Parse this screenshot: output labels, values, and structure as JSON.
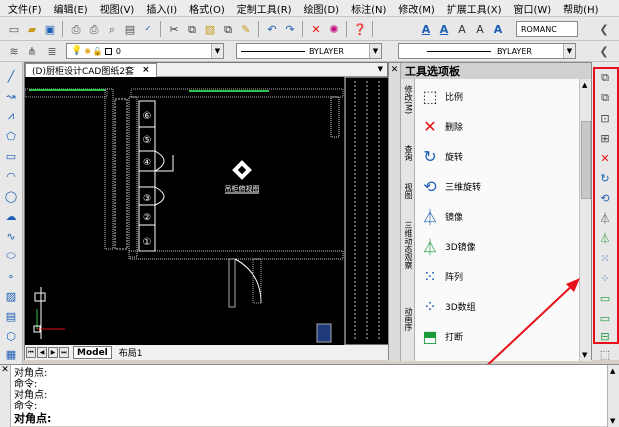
{
  "menubar": {
    "items": [
      "文件(F)",
      "编辑(E)",
      "视图(V)",
      "插入(I)",
      "格式(O)",
      "定制工具(R)",
      "绘图(D)",
      "标注(N)",
      "修改(M)",
      "扩展工具(X)",
      "窗口(W)",
      "帮助(H)"
    ]
  },
  "toolbar": {
    "text_style": "ROMANC",
    "layer": "0",
    "linetype": "BYLAYER",
    "lineweight": "BYLAYER"
  },
  "document": {
    "tab_title": "(D)厨柜设计CAD图纸2套",
    "close_glyph": "×",
    "layout_tabs": [
      "Model",
      "布局1"
    ],
    "drawing_label": "吊柜俯视图",
    "cabinet_numbers": [
      "⑥",
      "⑤",
      "④",
      "③",
      "②",
      "①"
    ]
  },
  "palette": {
    "title": "工具选项板",
    "vertical_tabs": [
      "修改(M)",
      "查询",
      "视图",
      "三维动态观察",
      "动画序"
    ],
    "items": [
      {
        "label": "比例",
        "icon": "scale-icon",
        "color": "#333333"
      },
      {
        "label": "删除",
        "icon": "erase-icon",
        "color": "#e01010"
      },
      {
        "label": "旋转",
        "icon": "rotate-icon",
        "color": "#1a5fb4"
      },
      {
        "label": "三维旋转",
        "icon": "rotate3d-icon",
        "color": "#1a5fb4"
      },
      {
        "label": "镜像",
        "icon": "mirror-icon",
        "color": "#1a5fb4"
      },
      {
        "label": "3D镜像",
        "icon": "mirror3d-icon",
        "color": "#1a9a3a"
      },
      {
        "label": "阵列",
        "icon": "array-icon",
        "color": "#1a5fb4"
      },
      {
        "label": "3D数组",
        "icon": "array3d-icon",
        "color": "#1a5fb4"
      },
      {
        "label": "打断",
        "icon": "break-icon",
        "color": "#1a9a3a"
      }
    ]
  },
  "command": {
    "lines": [
      "对角点:",
      "命令:",
      "对角点:",
      "命令:",
      "对角点:"
    ]
  },
  "colors": {
    "highlight": "#e8101a",
    "accent": "#1a5fb4"
  }
}
